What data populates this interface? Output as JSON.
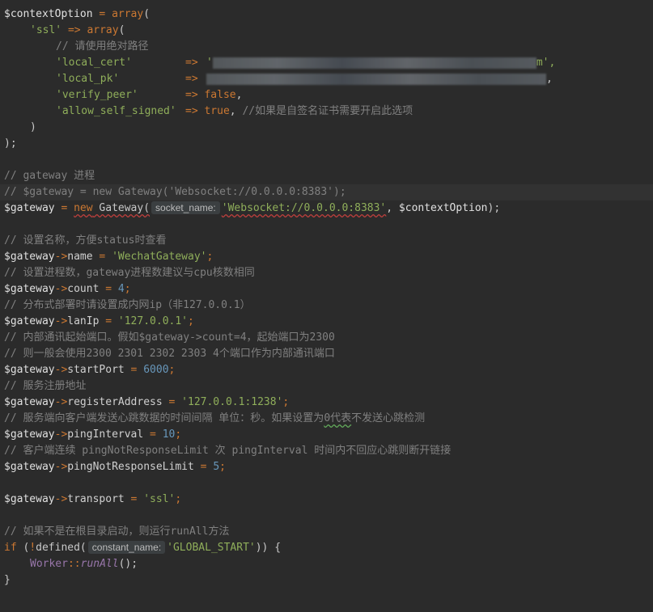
{
  "code": {
    "l1": {
      "v": "$contextOption",
      "op": " = ",
      "kw": "array",
      "p": "("
    },
    "l2": {
      "s": "'ssl'",
      "op": " => ",
      "kw": "array",
      "p": "("
    },
    "l3": {
      "c": "// 请使用绝对路径"
    },
    "l4": {
      "s": "'local_cert'",
      "op": "=>",
      "s2": "'",
      "end": "m',"
    },
    "l5": {
      "s": "'local_pk'",
      "op": "=>",
      "end": ","
    },
    "l6": {
      "s": "'verify_peer'",
      "op": "=>",
      "kw": "false",
      "p": ","
    },
    "l7": {
      "s": "'allow_self_signed'",
      "op": "=>",
      "kw": "true",
      "p": ", ",
      "c": "//如果是自签名证书需要开启此选项"
    },
    "l8": {
      "p": ")"
    },
    "l9": {
      "p": ");"
    },
    "l11": {
      "c": "// gateway 进程"
    },
    "l12": {
      "c": "// $gateway = new Gateway('Websocket://0.0.0.0:8383');"
    },
    "l13": {
      "v": "$gateway",
      "op": " = ",
      "kw": "new",
      "cls": " Gateway(",
      "hint": "socket_name:",
      "s": "'Websocket://0.0.0.0:8383'",
      "p": ", ",
      "v2": "$contextOption",
      "p2": ");"
    },
    "l15": {
      "c": "// 设置名称，方便status时查看"
    },
    "l16": {
      "v": "$gateway",
      "a": "->",
      "prop": "name",
      "op": " = ",
      "s": "'WechatGateway'",
      "p": ";"
    },
    "l17": {
      "c": "// 设置进程数，gateway进程数建议与cpu核数相同"
    },
    "l18": {
      "v": "$gateway",
      "a": "->",
      "prop": "count",
      "op": " = ",
      "n": "4",
      "p": ";"
    },
    "l19": {
      "c": "// 分布式部署时请设置成内网ip（非127.0.0.1）"
    },
    "l20": {
      "v": "$gateway",
      "a": "->",
      "prop": "lanIp",
      "op": " = ",
      "s": "'127.0.0.1'",
      "p": ";"
    },
    "l21": {
      "c": "// 内部通讯起始端口。假如$gateway->count=4，起始端口为2300"
    },
    "l22": {
      "c": "// 则一般会使用2300 2301 2302 2303 4个端口作为内部通讯端口"
    },
    "l23": {
      "v": "$gateway",
      "a": "->",
      "prop": "startPort",
      "op": " = ",
      "n": "6000",
      "p": ";"
    },
    "l24": {
      "c": "// 服务注册地址"
    },
    "l25": {
      "v": "$gateway",
      "a": "->",
      "prop": "registerAddress",
      "op": " = ",
      "s": "'127.0.0.1:1238'",
      "p": ";"
    },
    "l26": {
      "c1": "// 服务端向客户端发送心跳数据的时间间隔 单位：秒。如果设置为",
      "c2": "0代表",
      "c3": "不发送心跳检测"
    },
    "l27": {
      "v": "$gateway",
      "a": "->",
      "prop": "pingInterval",
      "op": " = ",
      "n": "10",
      "p": ";"
    },
    "l28": {
      "c": "// 客户端连续 pingNotResponseLimit 次 pingInterval 时间内不回应心跳则断开链接"
    },
    "l29": {
      "v": "$gateway",
      "a": "->",
      "prop": "pingNotResponseLimit",
      "op": " = ",
      "n": "5",
      "p": ";"
    },
    "l31": {
      "v": "$gateway",
      "a": "->",
      "prop": "transport",
      "op": " = ",
      "s": "'ssl'",
      "p": ";"
    },
    "l33": {
      "c": "// 如果不是在根目录启动，则运行runAll方法"
    },
    "l34": {
      "kw": "if",
      "p": " (",
      "op": "!",
      "fn": "defined(",
      "hint": "constant_name:",
      "s": "'GLOBAL_START'",
      "p2": ")) {"
    },
    "l35": {
      "cls": "Worker",
      "op": "::",
      "fn": "runAll",
      "p": "();"
    },
    "l36": {
      "p": "}"
    }
  }
}
